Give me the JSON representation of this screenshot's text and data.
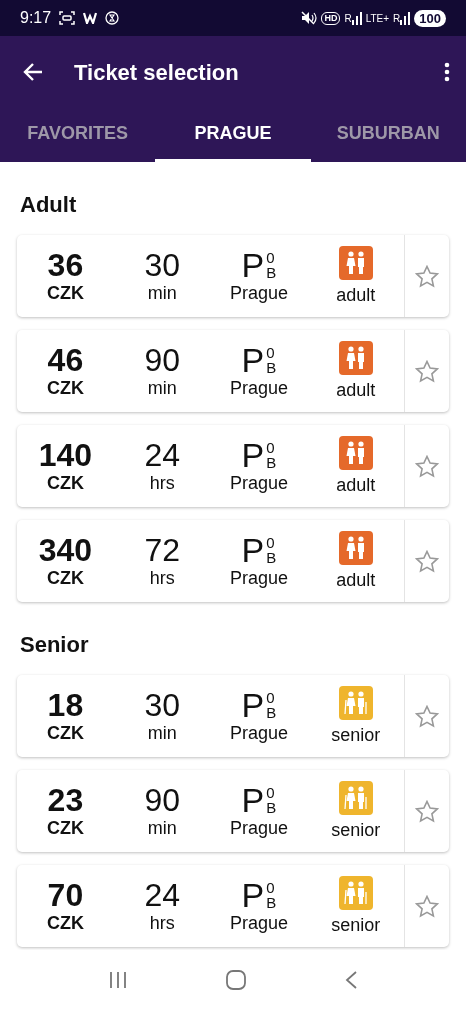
{
  "status_bar": {
    "time": "9:17",
    "hd": "HD",
    "roaming": [
      "R",
      "R"
    ],
    "network": "LTE+",
    "battery": "100"
  },
  "app_bar": {
    "title": "Ticket selection"
  },
  "tabs": [
    {
      "label": "FAVORITES",
      "selected": false
    },
    {
      "label": "PRAGUE",
      "selected": true
    },
    {
      "label": "SUBURBAN",
      "selected": false
    }
  ],
  "sections": [
    {
      "title": "Adult",
      "tickets": [
        {
          "price": "36",
          "currency": "CZK",
          "duration": "30",
          "unit": "min",
          "zone": "P",
          "zone_sup": "0",
          "zone_sub": "B",
          "zone_name": "Prague",
          "kind": "adult",
          "type_label": "adult",
          "favorite": false
        },
        {
          "price": "46",
          "currency": "CZK",
          "duration": "90",
          "unit": "min",
          "zone": "P",
          "zone_sup": "0",
          "zone_sub": "B",
          "zone_name": "Prague",
          "kind": "adult",
          "type_label": "adult",
          "favorite": false
        },
        {
          "price": "140",
          "currency": "CZK",
          "duration": "24",
          "unit": "hrs",
          "zone": "P",
          "zone_sup": "0",
          "zone_sub": "B",
          "zone_name": "Prague",
          "kind": "adult",
          "type_label": "adult",
          "favorite": false
        },
        {
          "price": "340",
          "currency": "CZK",
          "duration": "72",
          "unit": "hrs",
          "zone": "P",
          "zone_sup": "0",
          "zone_sub": "B",
          "zone_name": "Prague",
          "kind": "adult",
          "type_label": "adult",
          "favorite": false
        }
      ]
    },
    {
      "title": "Senior",
      "tickets": [
        {
          "price": "18",
          "currency": "CZK",
          "duration": "30",
          "unit": "min",
          "zone": "P",
          "zone_sup": "0",
          "zone_sub": "B",
          "zone_name": "Prague",
          "kind": "senior",
          "type_label": "senior",
          "favorite": false
        },
        {
          "price": "23",
          "currency": "CZK",
          "duration": "90",
          "unit": "min",
          "zone": "P",
          "zone_sup": "0",
          "zone_sub": "B",
          "zone_name": "Prague",
          "kind": "senior",
          "type_label": "senior",
          "favorite": false
        },
        {
          "price": "70",
          "currency": "CZK",
          "duration": "24",
          "unit": "hrs",
          "zone": "P",
          "zone_sup": "0",
          "zone_sub": "B",
          "zone_name": "Prague",
          "kind": "senior",
          "type_label": "senior",
          "favorite": false
        }
      ]
    }
  ]
}
